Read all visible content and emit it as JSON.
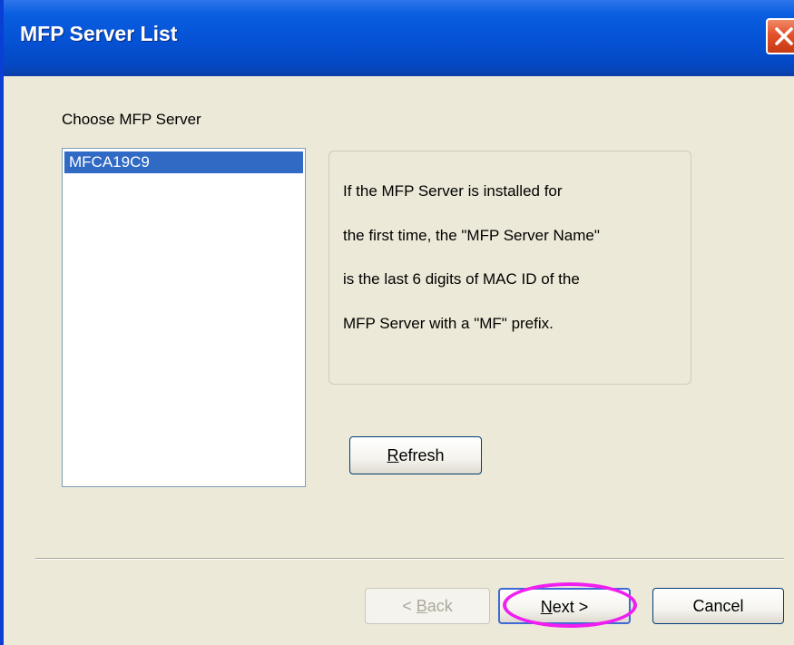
{
  "window": {
    "title": "MFP Server List"
  },
  "server_list": {
    "label": "Choose MFP Server",
    "items": [
      {
        "name": "MFCA19C9",
        "selected": true
      }
    ]
  },
  "info": {
    "lines": [
      "If the MFP Server is installed for",
      "the first time, the \"MFP Server Name\"",
      "is the last 6 digits of MAC ID of the",
      "MFP Server with a \"MF\" prefix."
    ]
  },
  "buttons": {
    "refresh": {
      "mnemonic": "R",
      "rest": "efresh"
    },
    "back": {
      "prefix": "< ",
      "mnemonic": "B",
      "rest": "ack",
      "enabled": false
    },
    "next": {
      "prefix": "",
      "mnemonic": "N",
      "rest": "ext >"
    },
    "cancel": {
      "label": "Cancel"
    }
  },
  "icons": {
    "close": "close-icon"
  },
  "colors": {
    "titlebar": "#0553d6",
    "selection": "#316ac5",
    "annotation": "#f01ef0",
    "close_button": "#e3512a"
  }
}
